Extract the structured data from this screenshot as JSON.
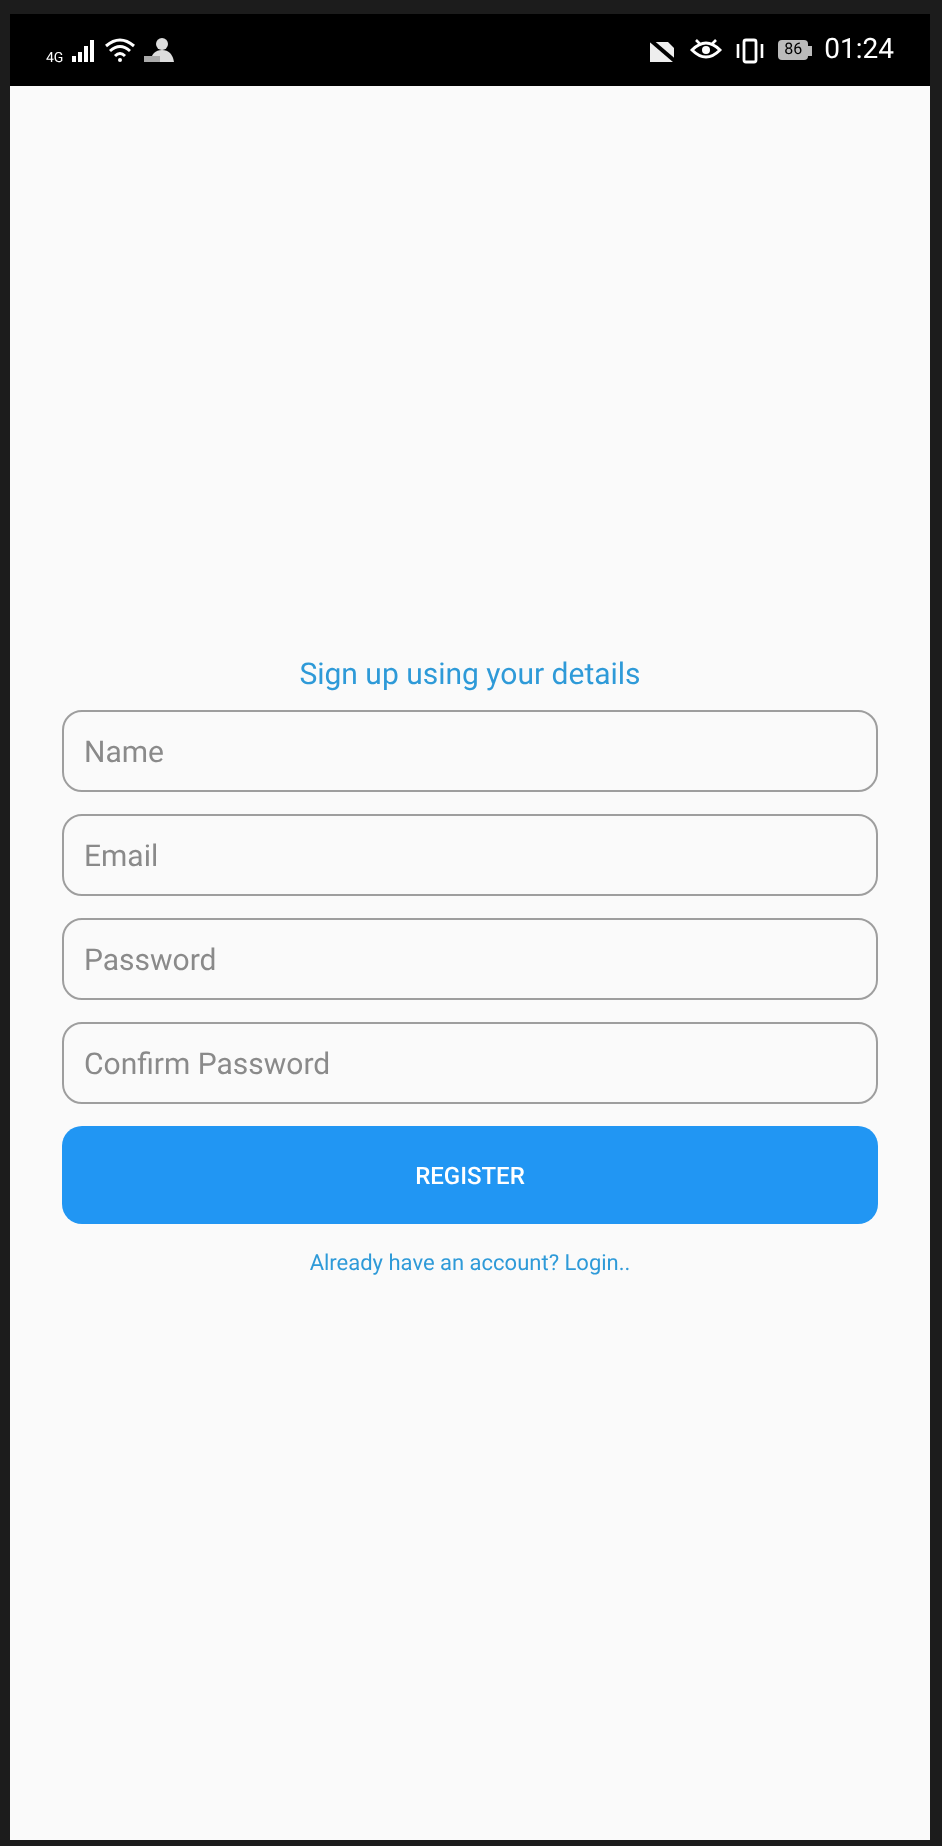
{
  "status_bar": {
    "network": "4G",
    "battery": "86",
    "time": "01:24"
  },
  "form": {
    "title": "Sign up using your details",
    "fields": [
      {
        "placeholder": "Name"
      },
      {
        "placeholder": "Email"
      },
      {
        "placeholder": "Password"
      },
      {
        "placeholder": "Confirm Password"
      }
    ],
    "button": "REGISTER",
    "login_link": "Already have an account? Login.."
  }
}
